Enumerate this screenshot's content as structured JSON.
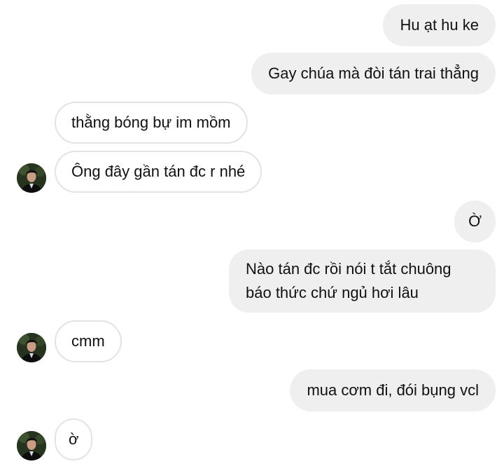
{
  "messages": [
    {
      "from": "me",
      "text": "Hu ạt hu ke"
    },
    {
      "from": "me",
      "text": "Gay chúa mà đòi tán trai thẳng"
    },
    {
      "from": "them",
      "text": "thằng bóng bự im mồm"
    },
    {
      "from": "them",
      "text": "Ông đây gần tán đc r nhé"
    },
    {
      "from": "me",
      "text": "Ờ"
    },
    {
      "from": "me",
      "text": "Nào tán đc rồi nói t tắt chuông báo thức chứ ngủ hơi lâu"
    },
    {
      "from": "them",
      "text": "cmm"
    },
    {
      "from": "me",
      "text": "mua cơm đi, đói bụng vcl"
    },
    {
      "from": "them",
      "text": "ờ"
    }
  ],
  "colors": {
    "outgoing_bubble": "#efefef",
    "incoming_border": "#e3e3e3",
    "text": "#111111"
  },
  "icons": {
    "avatar": "user-avatar-photo"
  }
}
